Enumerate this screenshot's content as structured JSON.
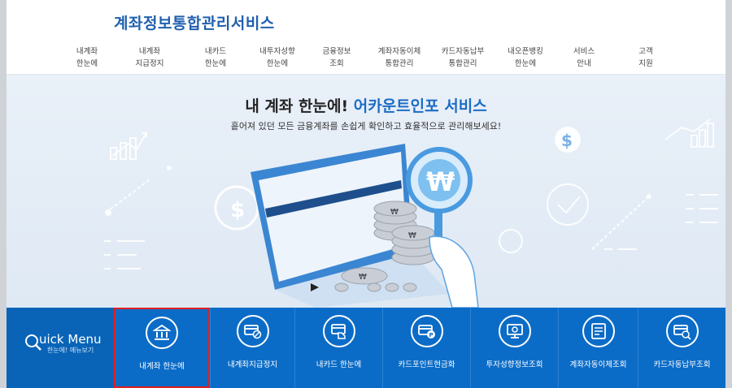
{
  "site": {
    "title": "계좌정보통합관리서비스"
  },
  "nav": [
    {
      "line1": "내계좌",
      "line2": "한눈에"
    },
    {
      "line1": "내계좌",
      "line2": "지급정지"
    },
    {
      "line1": "내카드",
      "line2": "한눈에"
    },
    {
      "line1": "내투자성향",
      "line2": "한눈에"
    },
    {
      "line1": "금융정보",
      "line2": "조회"
    },
    {
      "line1": "계좌자동이체",
      "line2": "통합관리"
    },
    {
      "line1": "카드자동납부",
      "line2": "통합관리"
    },
    {
      "line1": "내오픈뱅킹",
      "line2": "한눈에"
    },
    {
      "line1": "서비스",
      "line2": "안내"
    },
    {
      "line1": "고객",
      "line2": "지원"
    }
  ],
  "hero": {
    "title_main": "내 계좌 한눈에!",
    "title_accent": "어카운트인포 서비스",
    "subtitle": "흩어져 있던 모든 금융계좌를 손쉽게 확인하고 효율적으로 관리해보세요!"
  },
  "quick_menu": {
    "title": "uick Menu",
    "subtitle": "한눈에! 메뉴보기",
    "items": [
      {
        "label": "내계좌 한눈에",
        "icon": "bank-icon"
      },
      {
        "label": "내계좌지급정지",
        "icon": "card-stop-icon"
      },
      {
        "label": "내카드 한눈에",
        "icon": "card-hand-icon"
      },
      {
        "label": "카드포인트현금화",
        "icon": "card-point-icon"
      },
      {
        "label": "투자성향정보조회",
        "icon": "monitor-chart-icon"
      },
      {
        "label": "계좌자동이체조회",
        "icon": "auto-transfer-icon"
      },
      {
        "label": "카드자동납부조회",
        "icon": "card-search-icon"
      }
    ]
  },
  "colors": {
    "brand": "#1f5fae",
    "accent": "#1c6cc5",
    "quick_bg": "#0b6cc7",
    "highlight": "#e02020"
  }
}
